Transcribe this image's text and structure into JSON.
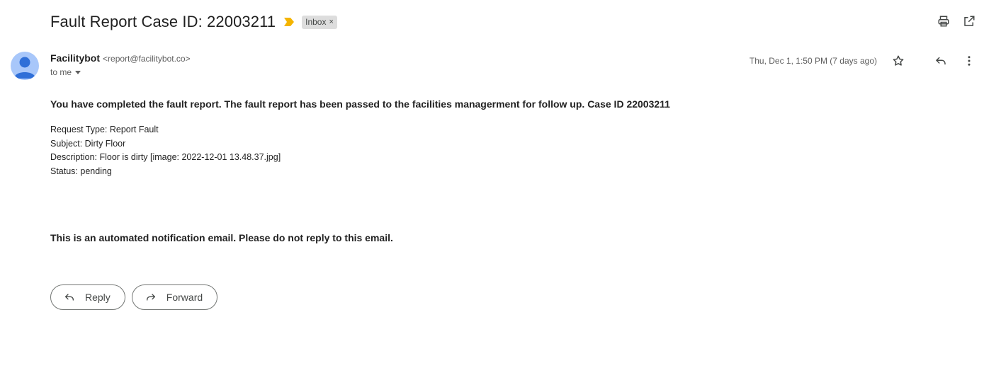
{
  "email": {
    "subject": "Fault Report Case ID: 22003211",
    "label": "Inbox",
    "label_close": "×",
    "sender_name": "Facilitybot",
    "sender_email": "<report@facilitybot.co>",
    "recipient": "to me",
    "date": "Thu, Dec 1, 1:50 PM (7 days ago)",
    "headline": "You have completed the fault report. The fault report has been passed to the facilities managerment for follow up. Case ID 22003211",
    "details": [
      "Request Type: Report Fault",
      "Subject: Dirty Floor",
      "Description: Floor is dirty [image: 2022-12-01 13.48.37.jpg]",
      "Status: pending"
    ],
    "footer_note": "This is an automated notification email. Please do not reply to this email."
  },
  "actions": {
    "reply_label": "Reply",
    "forward_label": "Forward"
  },
  "icons": {
    "importance": "importance-marker-icon",
    "print": "print-icon",
    "open_new_window": "open-in-new-window-icon",
    "star": "star-icon",
    "reply": "reply-icon",
    "more": "more-vertical-icon",
    "forward": "forward-icon",
    "avatar": "person-icon"
  },
  "colors": {
    "importance": "#f4b400",
    "label_bg": "#dddddd",
    "avatar_bg": "#a8c7fa",
    "avatar_fg": "#2f6fd8"
  }
}
